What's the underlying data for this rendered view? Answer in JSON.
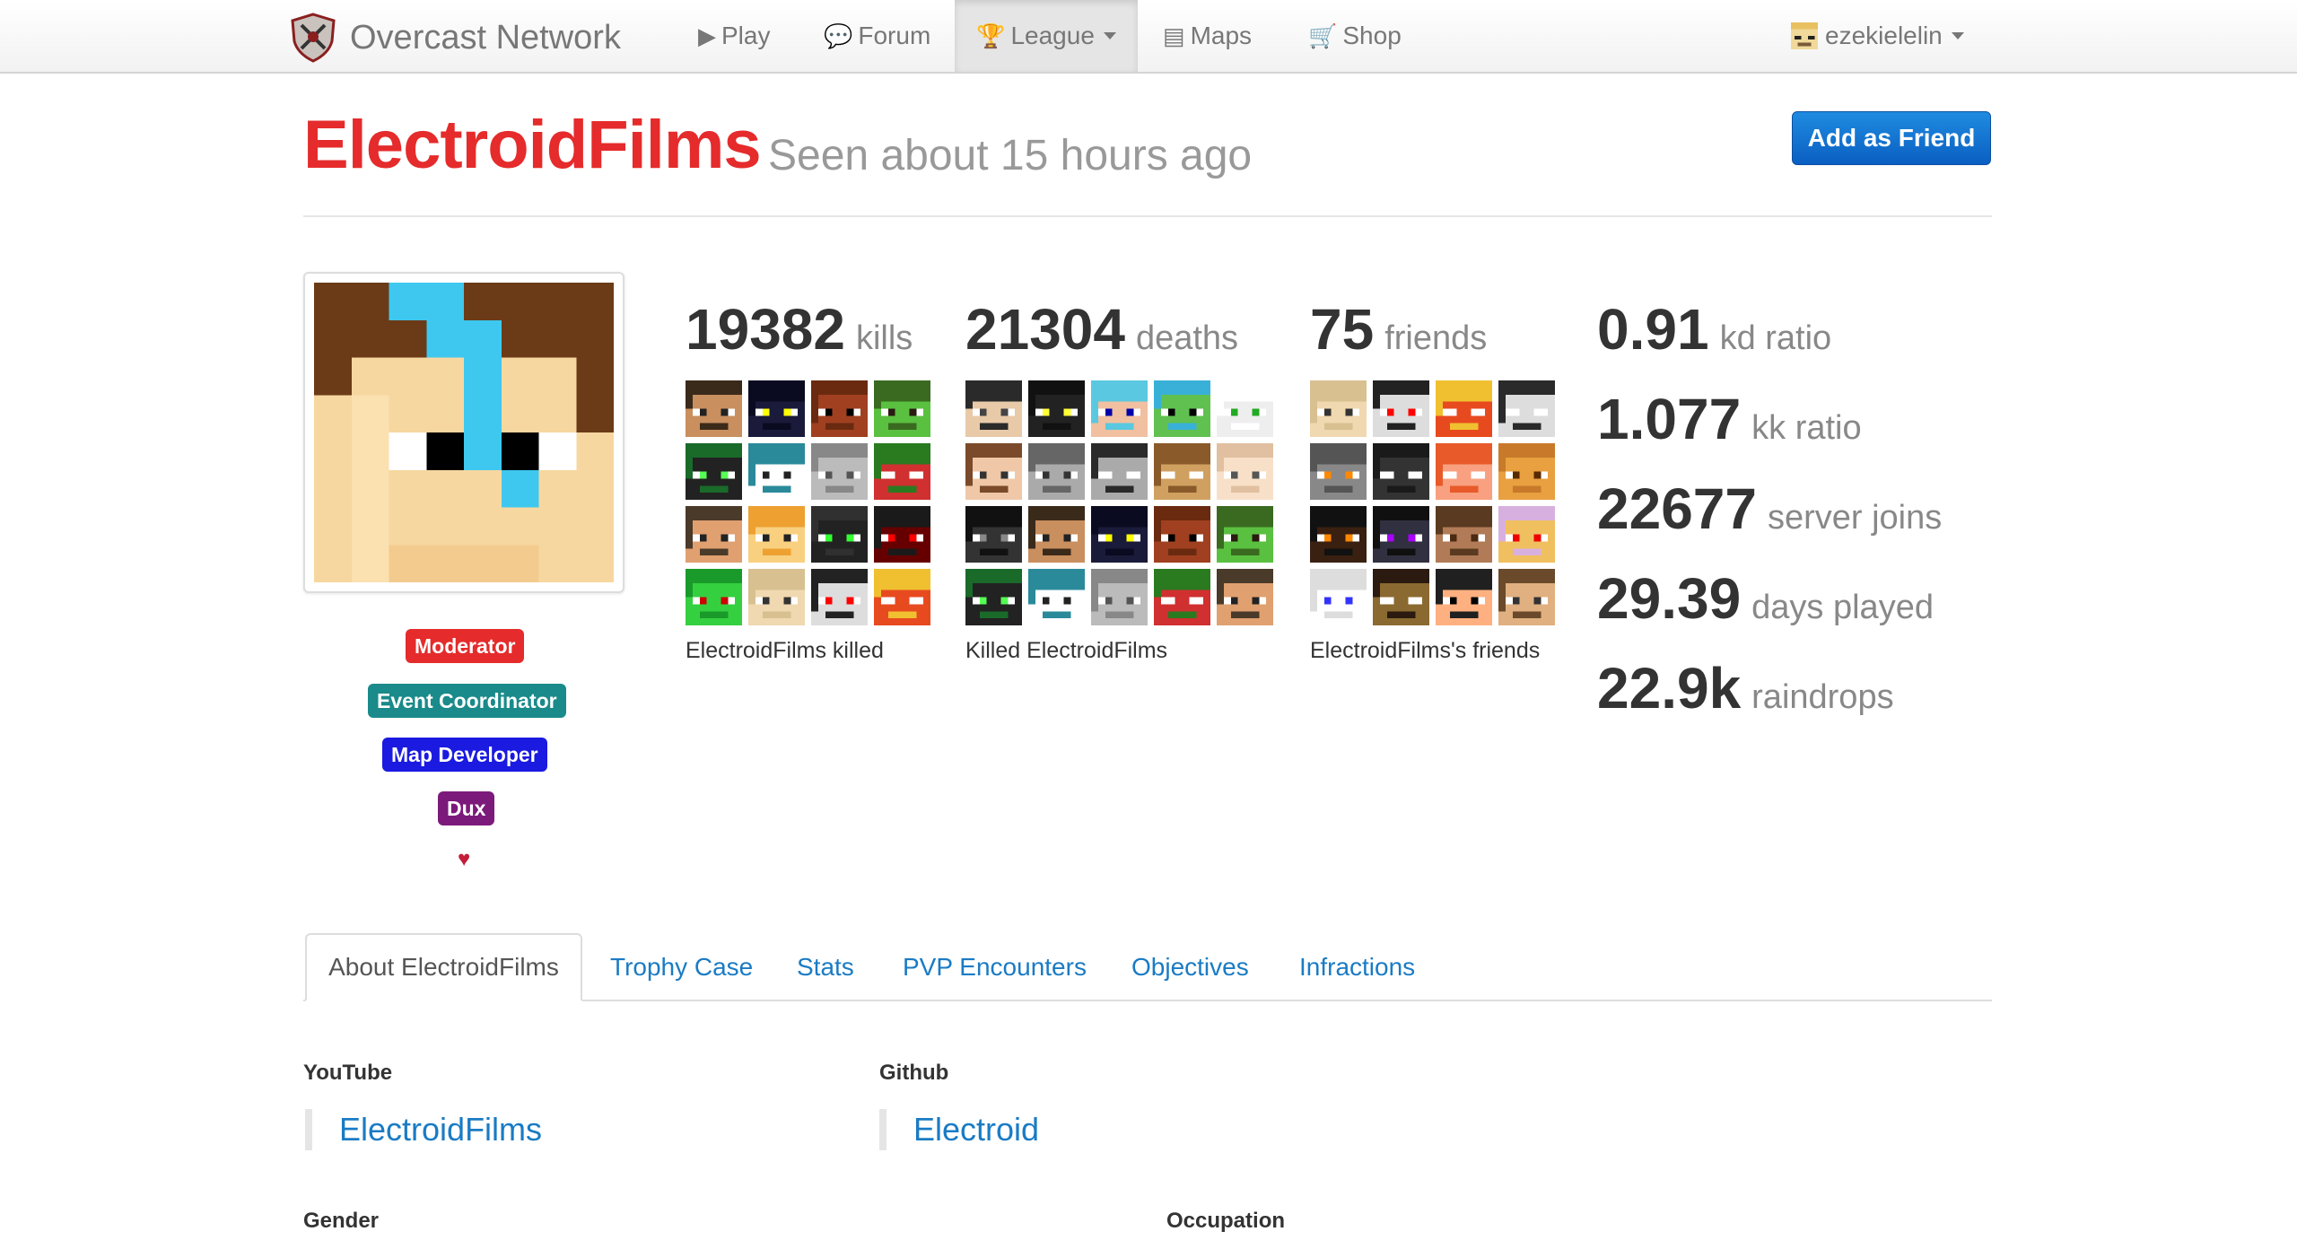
{
  "nav": {
    "brand": "Overcast Network",
    "items": [
      {
        "label": "Play",
        "icon": "play-icon"
      },
      {
        "label": "Forum",
        "icon": "comments-icon"
      },
      {
        "label": "League",
        "icon": "trophy-icon"
      },
      {
        "label": "Maps",
        "icon": "list-icon"
      },
      {
        "label": "Shop",
        "icon": "cart-icon"
      }
    ],
    "username": "ezekielelin"
  },
  "profile": {
    "name": "ElectroidFilms",
    "seen": "Seen about 15 hours ago",
    "add_friend": "Add as Friend",
    "name_color": "#e52b2b",
    "badges": [
      {
        "label": "Moderator",
        "color": "#e52b2b"
      },
      {
        "label": "Event Coordinator",
        "color": "#1a8a8a"
      },
      {
        "label": "Map Developer",
        "color": "#1a1ae0"
      },
      {
        "label": "Dux",
        "color": "#7b1a7b"
      }
    ],
    "heart": "♥"
  },
  "stats": {
    "kills": {
      "value": "19382",
      "unit": "kills",
      "caption": "ElectroidFilms killed"
    },
    "deaths": {
      "value": "21304",
      "unit": "deaths",
      "caption": "Killed ElectroidFilms"
    },
    "friends": {
      "value": "75",
      "unit": "friends",
      "caption": "ElectroidFilms's friends"
    },
    "kd": {
      "value": "0.91",
      "unit": "kd ratio"
    },
    "kk": {
      "value": "1.077",
      "unit": "kk ratio"
    },
    "joins": {
      "value": "22677",
      "unit": "server joins"
    },
    "days": {
      "value": "29.39",
      "unit": "days played"
    },
    "raindrops": {
      "value": "22.9k",
      "unit": "raindrops"
    }
  },
  "tabs": [
    "About ElectroidFilms",
    "Trophy Case",
    "Stats",
    "PVP Encounters",
    "Objectives",
    "Infractions"
  ],
  "about": {
    "youtube_label": "YouTube",
    "youtube_value": "ElectroidFilms",
    "github_label": "Github",
    "github_value": "Electroid",
    "gender_label": "Gender",
    "occupation_label": "Occupation"
  }
}
